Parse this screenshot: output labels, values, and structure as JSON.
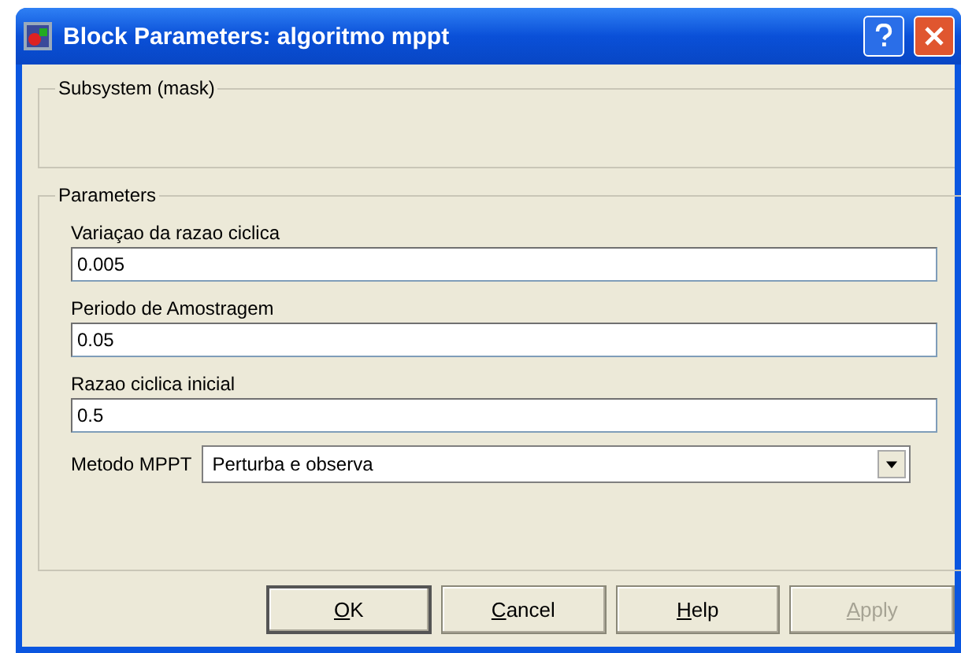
{
  "window": {
    "title": "Block Parameters: algoritmo mppt"
  },
  "subsystem": {
    "title": "Subsystem (mask)"
  },
  "parameters": {
    "title": "Parameters",
    "fields": [
      {
        "kind": "text",
        "label": "Variaçao da razao ciclica",
        "value": "0.005"
      },
      {
        "kind": "text",
        "label": "Periodo de Amostragem",
        "value": "0.05"
      },
      {
        "kind": "text",
        "label": "Razao ciclica inicial",
        "value": "0.5"
      },
      {
        "kind": "select",
        "label": "Metodo MPPT",
        "value": "Perturba e observa"
      }
    ]
  },
  "buttons": [
    {
      "label": "OK",
      "disabled": false,
      "default": true
    },
    {
      "label": "Cancel",
      "disabled": false,
      "default": false
    },
    {
      "label": "Help",
      "disabled": false,
      "default": false
    },
    {
      "label": "Apply",
      "disabled": true,
      "default": false
    }
  ]
}
